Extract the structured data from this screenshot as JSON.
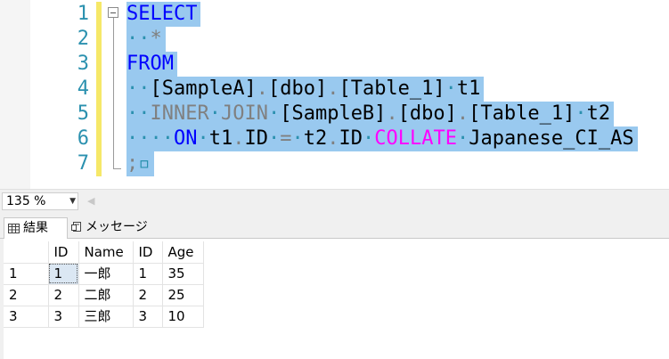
{
  "editor": {
    "line_numbers": [
      "1",
      "2",
      "3",
      "4",
      "5",
      "6",
      "7"
    ],
    "lines": [
      [
        {
          "t": "SELECT",
          "c": "kw"
        }
      ],
      [
        {
          "t": "··",
          "c": "ws"
        },
        {
          "t": "*",
          "c": "gray"
        }
      ],
      [
        {
          "t": "FROM",
          "c": "kw"
        }
      ],
      [
        {
          "t": "··",
          "c": "ws"
        },
        {
          "t": "[SampleA]",
          "c": "ident"
        },
        {
          "t": ".",
          "c": "gray"
        },
        {
          "t": "[dbo]",
          "c": "ident"
        },
        {
          "t": ".",
          "c": "gray"
        },
        {
          "t": "[Table_1]",
          "c": "ident"
        },
        {
          "t": "·",
          "c": "ws"
        },
        {
          "t": "t1",
          "c": "ident"
        }
      ],
      [
        {
          "t": "··",
          "c": "ws"
        },
        {
          "t": "INNER",
          "c": "gray"
        },
        {
          "t": "·",
          "c": "ws"
        },
        {
          "t": "JOIN",
          "c": "gray"
        },
        {
          "t": "·",
          "c": "ws"
        },
        {
          "t": "[SampleB]",
          "c": "ident"
        },
        {
          "t": ".",
          "c": "gray"
        },
        {
          "t": "[dbo]",
          "c": "ident"
        },
        {
          "t": ".",
          "c": "gray"
        },
        {
          "t": "[Table_1]",
          "c": "ident"
        },
        {
          "t": "·",
          "c": "ws"
        },
        {
          "t": "t2",
          "c": "ident"
        }
      ],
      [
        {
          "t": "····",
          "c": "ws"
        },
        {
          "t": "ON",
          "c": "kw"
        },
        {
          "t": "·",
          "c": "ws"
        },
        {
          "t": "t1",
          "c": "ident"
        },
        {
          "t": ".",
          "c": "gray"
        },
        {
          "t": "ID",
          "c": "ident"
        },
        {
          "t": "·",
          "c": "ws"
        },
        {
          "t": "=",
          "c": "gray"
        },
        {
          "t": "·",
          "c": "ws"
        },
        {
          "t": "t2",
          "c": "ident"
        },
        {
          "t": ".",
          "c": "gray"
        },
        {
          "t": "ID",
          "c": "ident"
        },
        {
          "t": "·",
          "c": "ws"
        },
        {
          "t": "COLLATE",
          "c": "pink"
        },
        {
          "t": "·",
          "c": "ws"
        },
        {
          "t": "Japanese_CI_AS",
          "c": "ident"
        }
      ],
      [
        {
          "t": ";",
          "c": "gray"
        },
        {
          "t": "▫",
          "c": "ws"
        }
      ]
    ]
  },
  "zoom": {
    "value": "135 %"
  },
  "tabs": {
    "results": "結果",
    "messages": "メッセージ"
  },
  "grid": {
    "headers": [
      "",
      "ID",
      "Name",
      "ID",
      "Age"
    ],
    "rows": [
      [
        "1",
        "1",
        "一郎",
        "1",
        "35"
      ],
      [
        "2",
        "2",
        "二郎",
        "2",
        "25"
      ],
      [
        "3",
        "3",
        "三郎",
        "3",
        "10"
      ]
    ]
  },
  "colors": {
    "selection": "#99c9ef",
    "keyword": "#0000ff",
    "line_number": "#2b91af",
    "collate": "#ff00ff",
    "track": "#f6e868"
  }
}
